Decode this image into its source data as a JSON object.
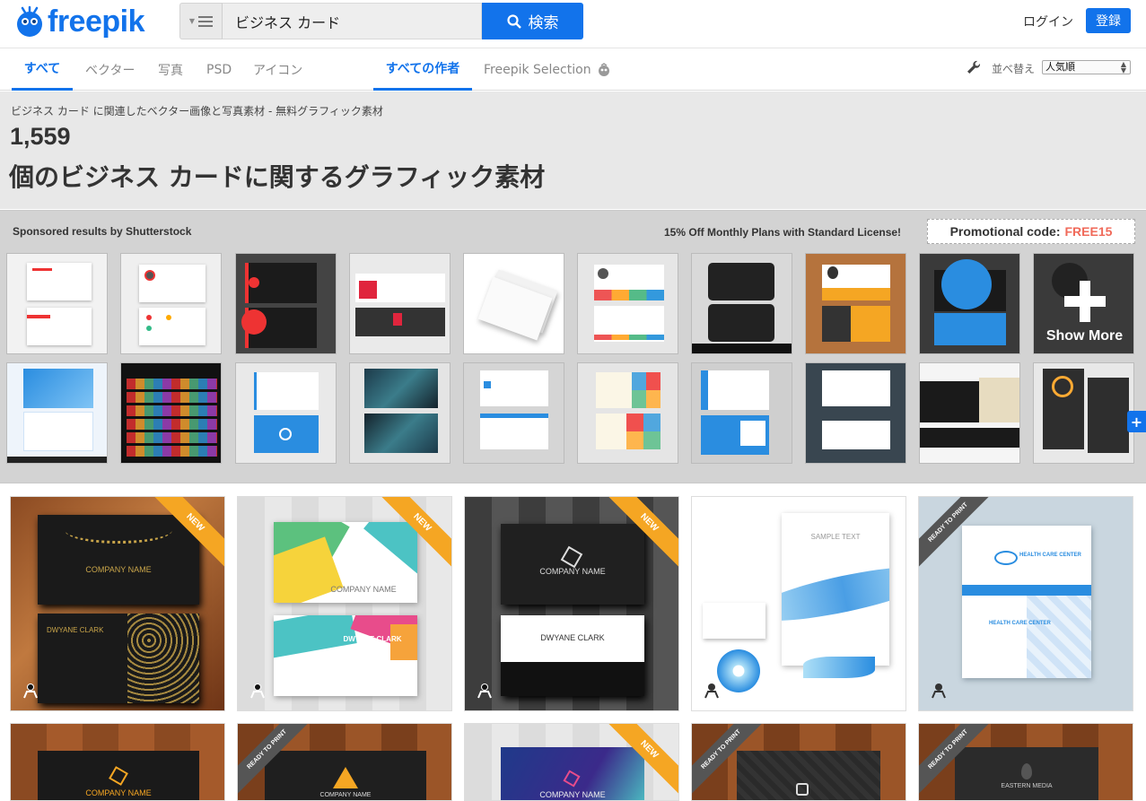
{
  "header": {
    "logo_text": "freepik",
    "search_value": "ビジネス カード",
    "search_button": "検索",
    "login": "ログイン",
    "signup": "登録"
  },
  "tabs": {
    "all": "すべて",
    "vector": "ベクター",
    "photo": "写真",
    "psd": "PSD",
    "icon": "アイコン",
    "all_authors": "すべての作者",
    "selection": "Freepik Selection",
    "sort_label": "並べ替え",
    "sort_value": "人気順"
  },
  "title": {
    "subtitle": "ビジネス カード に関連したベクター画像と写真素材 - 無料グラフィック素材",
    "count": "1,559",
    "headline": "個のビジネス カードに関するグラフィック素材"
  },
  "sponsored": {
    "label": "Sponsored results by Shutterstock",
    "offer": "15% Off Monthly Plans with Standard License!",
    "promo_prefix": "Promotional code:",
    "promo_code": "FREE15",
    "show_more": "Show More"
  },
  "grid": {
    "ribbon_new": "NEW",
    "ribbon_ready": "READY TO PRINT",
    "tile1_company": "COMPANY NAME",
    "tile1_person": "DWYANE CLARK",
    "tile2_company": "COMPANY NAME",
    "tile2_person": "DWYANE CLARK",
    "tile3_company": "COMPANY NAME",
    "tile3_person": "DWYANE CLARK",
    "tile4_text": "SAMPLE TEXT",
    "tile5_title": "HEALTH CARE CENTER",
    "tile5_title2": "HEALTH CARE CENTER",
    "tile6_company": "COMPANY NAME",
    "tile7_company": "COMPANY NAME",
    "tile8_company": "COMPANY NAME",
    "tile10_company": "EASTERN MEDIA"
  },
  "colors": {
    "brand": "#1273eb",
    "ribbon": "#f5a623",
    "promo": "#f06a5a"
  }
}
